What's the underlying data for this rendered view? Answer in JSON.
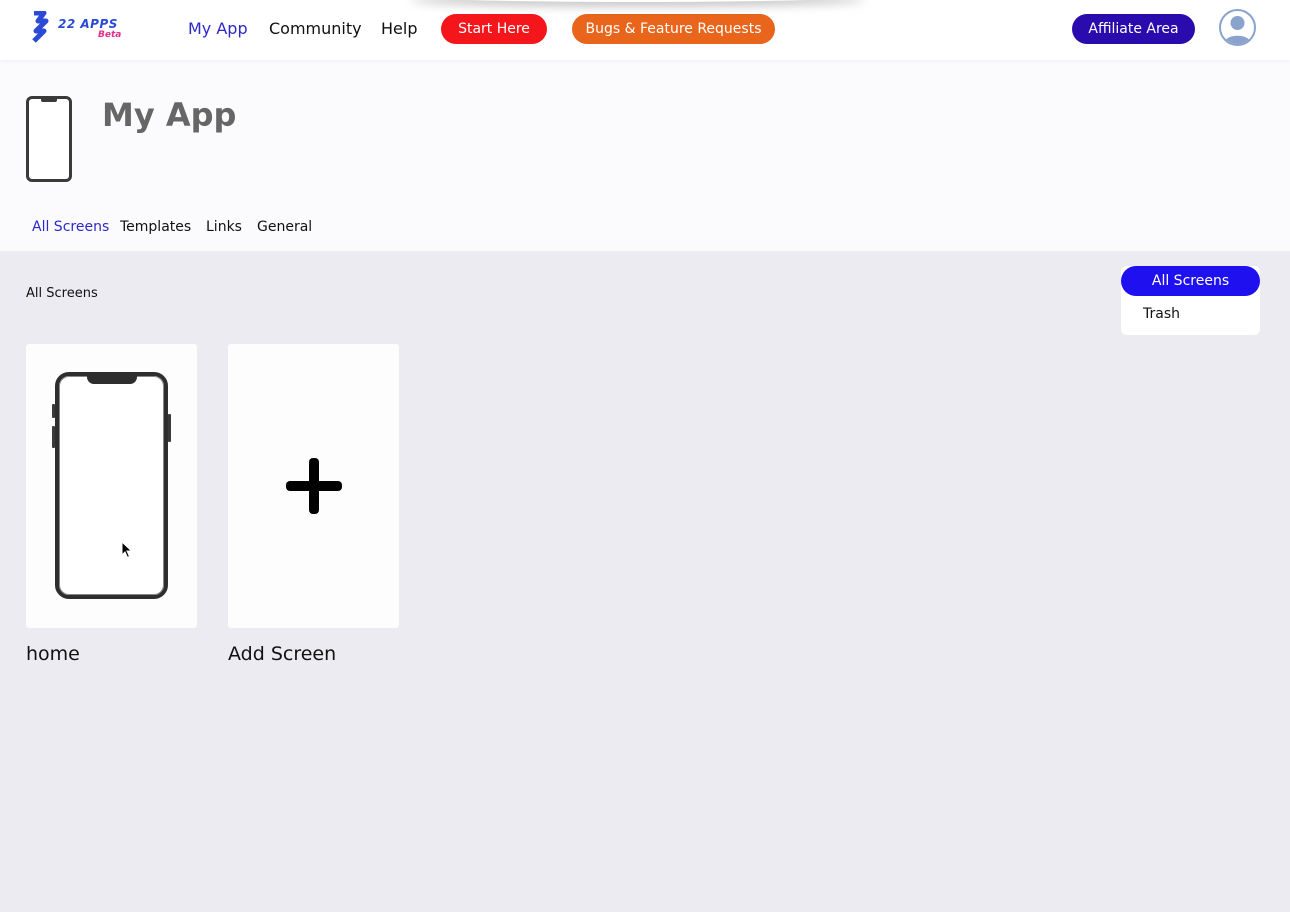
{
  "brand": {
    "logo_text": "22 APPS",
    "logo_badge": "Beta",
    "accent": "#2d28c9"
  },
  "nav": {
    "links": [
      {
        "label": "My App",
        "active": true
      },
      {
        "label": "Community",
        "active": false
      },
      {
        "label": "Help",
        "active": false
      }
    ],
    "start_here": {
      "label": "Start Here",
      "color": "#f5161c"
    },
    "bugs": {
      "label": "Bugs & Feature Requests",
      "color": "#e8651b"
    },
    "affiliate": {
      "label": "Affiliate Area",
      "color": "#2a0cae"
    },
    "avatar_icon": "user-avatar-icon"
  },
  "header": {
    "title": "My App",
    "tabs": [
      {
        "label": "All Screens",
        "active": true
      },
      {
        "label": "Templates",
        "active": false
      },
      {
        "label": "Links",
        "active": false
      },
      {
        "label": "General",
        "active": false
      }
    ]
  },
  "main": {
    "section_label": "All Screens",
    "filter": {
      "active_label": "All Screens",
      "trash_label": "Trash",
      "active_color": "#1f10f0"
    },
    "cards": [
      {
        "label": "home",
        "icon": "phone-preview-icon"
      },
      {
        "label": "Add Screen",
        "icon": "plus-icon"
      }
    ]
  }
}
